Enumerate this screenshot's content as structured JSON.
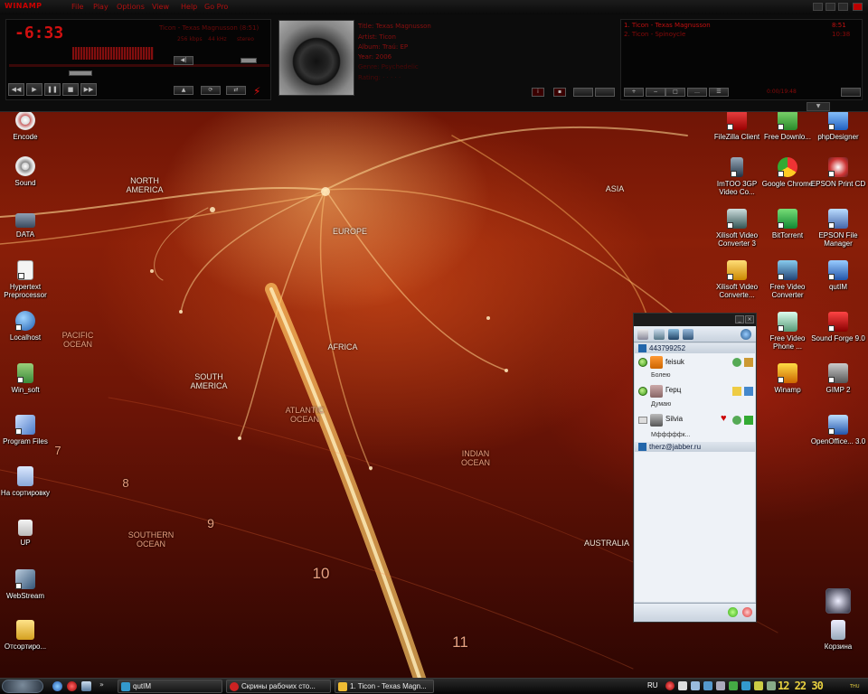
{
  "winamp": {
    "logo": "WINAMP",
    "menu": [
      "File",
      "Play",
      "Options",
      "View",
      "Help",
      "Go Pro"
    ],
    "time": "-6:33",
    "song_title": "Ticon - Texas Magnusson (8:51)",
    "bitrate": "256 kbps",
    "samplerate": "44 kHz",
    "channels": "stereo",
    "meta": {
      "title": "Title: Texas Magnusson",
      "artist": "Artist: Ticon",
      "album": "Album: Traú: EP",
      "year": "Year: 2006",
      "genre": "Genre: Psychedelic",
      "rating": "Rating: ·  ·  ·  ·  ·"
    },
    "playlist": [
      {
        "title": "1. Ticon - Texas Magnusson",
        "time": "8:51"
      },
      {
        "title": "2. Ticon - Spinoycle",
        "time": "10:38"
      }
    ],
    "playlist_total": "0:00/19:48",
    "controls": [
      "◀◀",
      "▶",
      "❚❚",
      "■",
      "▶▶"
    ],
    "colors": {
      "accent": "#d01010",
      "bg": "#0c0c0c"
    }
  },
  "desktop": {
    "map_labels": [
      "NORTH AMERICA",
      "EUROPE",
      "ASIA",
      "PACIFIC OCEAN",
      "AFRICA",
      "SOUTH AMERICA",
      "ATLANTIC OCEAN",
      "INDIAN OCEAN",
      "SOUTHERN OCEAN",
      "AUSTRALIA"
    ],
    "map_numbers": [
      "7",
      "8",
      "9",
      "10",
      "11"
    ],
    "icons_left": [
      "Encode",
      "Sound",
      "DATA",
      "Hypertext Preprocessor",
      "Localhost",
      "Win_soft",
      "Program Files",
      "На сортировку",
      "UP",
      "WebStream",
      "Отсортиро..."
    ],
    "icons_right": [
      "FileZilla Client",
      "Free Downlo...",
      "phpDesigner",
      "ImTOO 3GP Video Co...",
      "Google Chrome",
      "EPSON Print CD",
      "Xilisoft Video Converter 3",
      "BitTorrent",
      "EPSON File Manager",
      "Xilisoft Video Converte...",
      "Free Video Converter",
      "qutIM",
      "Free Video Phone ...",
      "Sound Forge 9.0",
      "Winamp",
      "GIMP 2",
      "OpenOffice... 3.0",
      "Корзина"
    ]
  },
  "qutim": {
    "accounts": [
      "443799252",
      "therz@jabber.ru"
    ],
    "contacts": [
      {
        "name": "feisuk",
        "status_msg": "Болею"
      },
      {
        "name": "Герц",
        "status_msg": "Думаю"
      },
      {
        "name": "Silvia",
        "status_msg": "Мфффффк..."
      }
    ]
  },
  "taskbar": {
    "tasks": [
      "qutIM",
      "Скрины рабочих сто...",
      "1. Ticon - Texas Magn..."
    ],
    "lang": "RU",
    "time": "12:22",
    "date_day": "THU",
    "clock_display": "12 22 30"
  }
}
